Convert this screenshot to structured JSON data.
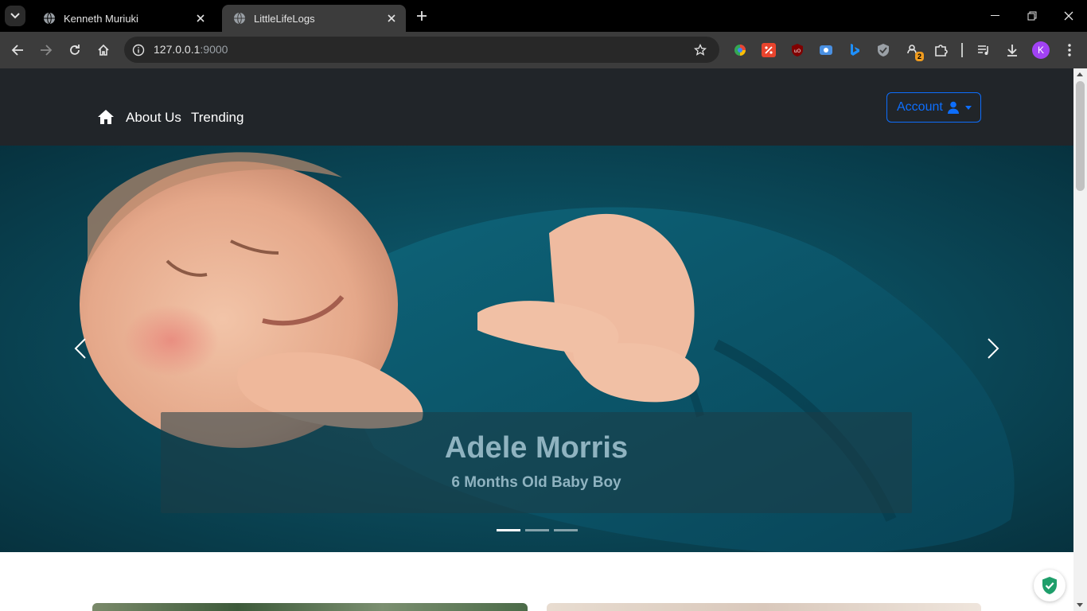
{
  "browser": {
    "tabs": [
      {
        "title": "Kenneth Muriuki",
        "active": false
      },
      {
        "title": "LittleLifeLogs",
        "active": true
      }
    ],
    "url_host": "127.0.0.1",
    "url_port": ":9000",
    "profile_initial": "K",
    "extension_badge": "2"
  },
  "nav": {
    "links": [
      "About Us",
      "Trending"
    ],
    "account_label": "Account"
  },
  "carousel": {
    "slide_title": "Adele Morris",
    "slide_subtitle": "6 Months Old Baby Boy",
    "slide_count": 3,
    "active_slide": 0
  },
  "colors": {
    "navbar_bg": "#212529",
    "account_accent": "#0d6efd",
    "photo_teal": "#0b4a5c"
  }
}
